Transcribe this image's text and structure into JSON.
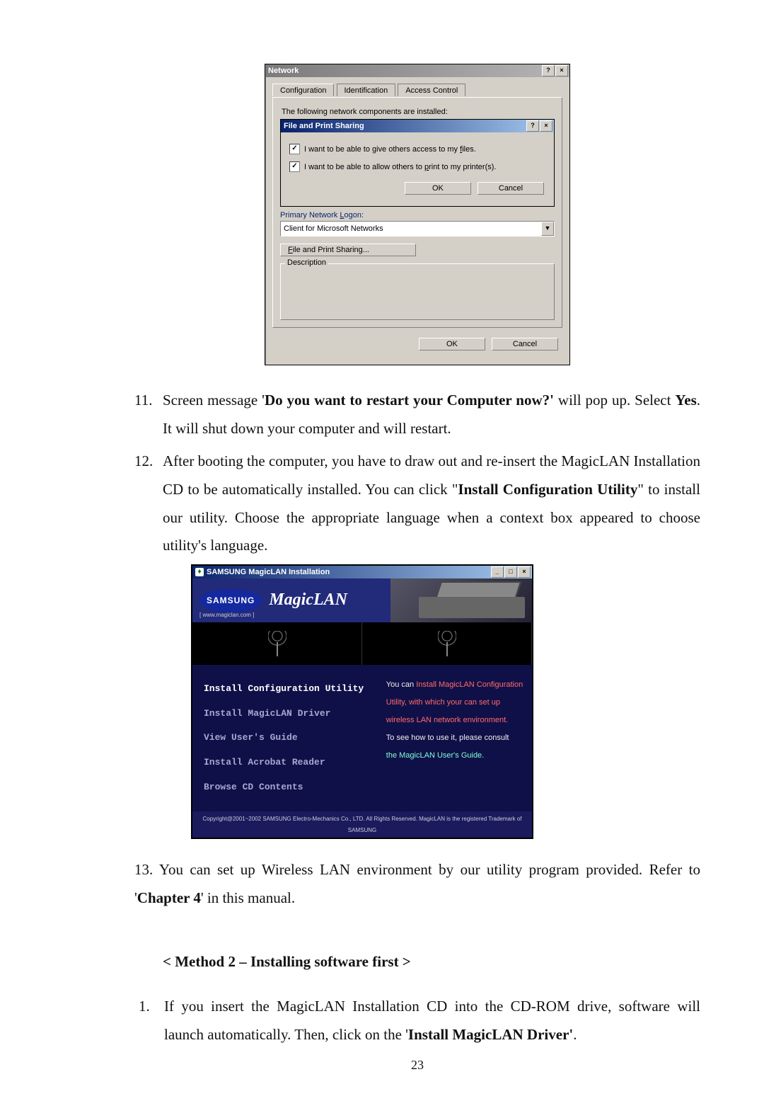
{
  "network_dialog": {
    "title": "Network",
    "help_btn": "?",
    "close_btn": "×",
    "tabs": {
      "configuration": "Configuration",
      "identification": "Identification",
      "access_control": "Access Control"
    },
    "installed_label": "The following network components are installed:",
    "sub_dialog": {
      "title": "File and Print Sharing",
      "cb1_label": "I want to be able to give others access to my files.",
      "cb2_label": "I want to be able to allow others to print to my printer(s).",
      "ok": "OK",
      "cancel": "Cancel"
    },
    "primary_logon_label": "Primary Network Logon:",
    "primary_logon_value": "Client for Microsoft Networks",
    "fps_button": "File and Print Sharing...",
    "description_label": "Description",
    "ok": "OK",
    "cancel": "Cancel"
  },
  "steps": {
    "s11_num": "11.",
    "s11_a": "Screen message '",
    "s11_b": "Do you want to restart your Computer now?'",
    "s11_c": " will pop up. Select ",
    "s11_d": "Yes",
    "s11_e": ". It will shut down your computer and will restart.",
    "s12_num": "12.",
    "s12_a": "After booting the computer, you have to draw out and re-insert the MagicLAN Installation CD to be automatically installed. You can click \"",
    "s12_b": "Install Configuration Utility",
    "s12_c": "\" to install our utility. Choose the appropriate language when a context box appeared to choose utility's language.",
    "s13_a": "13. You can set up Wireless LAN environment by our utility program provided. Refer to '",
    "s13_b": "Chapter 4",
    "s13_c": "' in this manual."
  },
  "magiclan": {
    "win_title": "SAMSUNG MagicLAN Installation",
    "samsung": "SAMSUNG",
    "url": "[ www.magiclan.com ]",
    "brand": "MagicLAN",
    "menu": {
      "m1": "Install Configuration Utility",
      "m2": "Install MagicLAN Driver",
      "m3": "View User's Guide",
      "m4": "Install Acrobat Reader",
      "m5": "Browse CD Contents"
    },
    "desc": {
      "l1a": "You can ",
      "l1b": "Install MagicLAN Configuration",
      "l2": "Utility, with which your can set up",
      "l3": "wireless LAN network environment.",
      "l4": "To see how to use it, please consult",
      "l5": "the MagicLAN User's Guide."
    },
    "copyright": "Copyright@2001~2002 SAMSUNG Electro-Mechanics Co., LTD. All Rights Reserved. MagicLAN is the registered Trademark of SAMSUNG"
  },
  "method2": {
    "title": "< Method 2 – Installing software first >",
    "s1_num": "1.",
    "s1_a": "If you insert the MagicLAN Installation CD into the CD-ROM drive, software will launch automatically.  Then, click on the  '",
    "s1_b": "Install MagicLAN Driver'",
    "s1_c": "."
  },
  "page_number": "23"
}
